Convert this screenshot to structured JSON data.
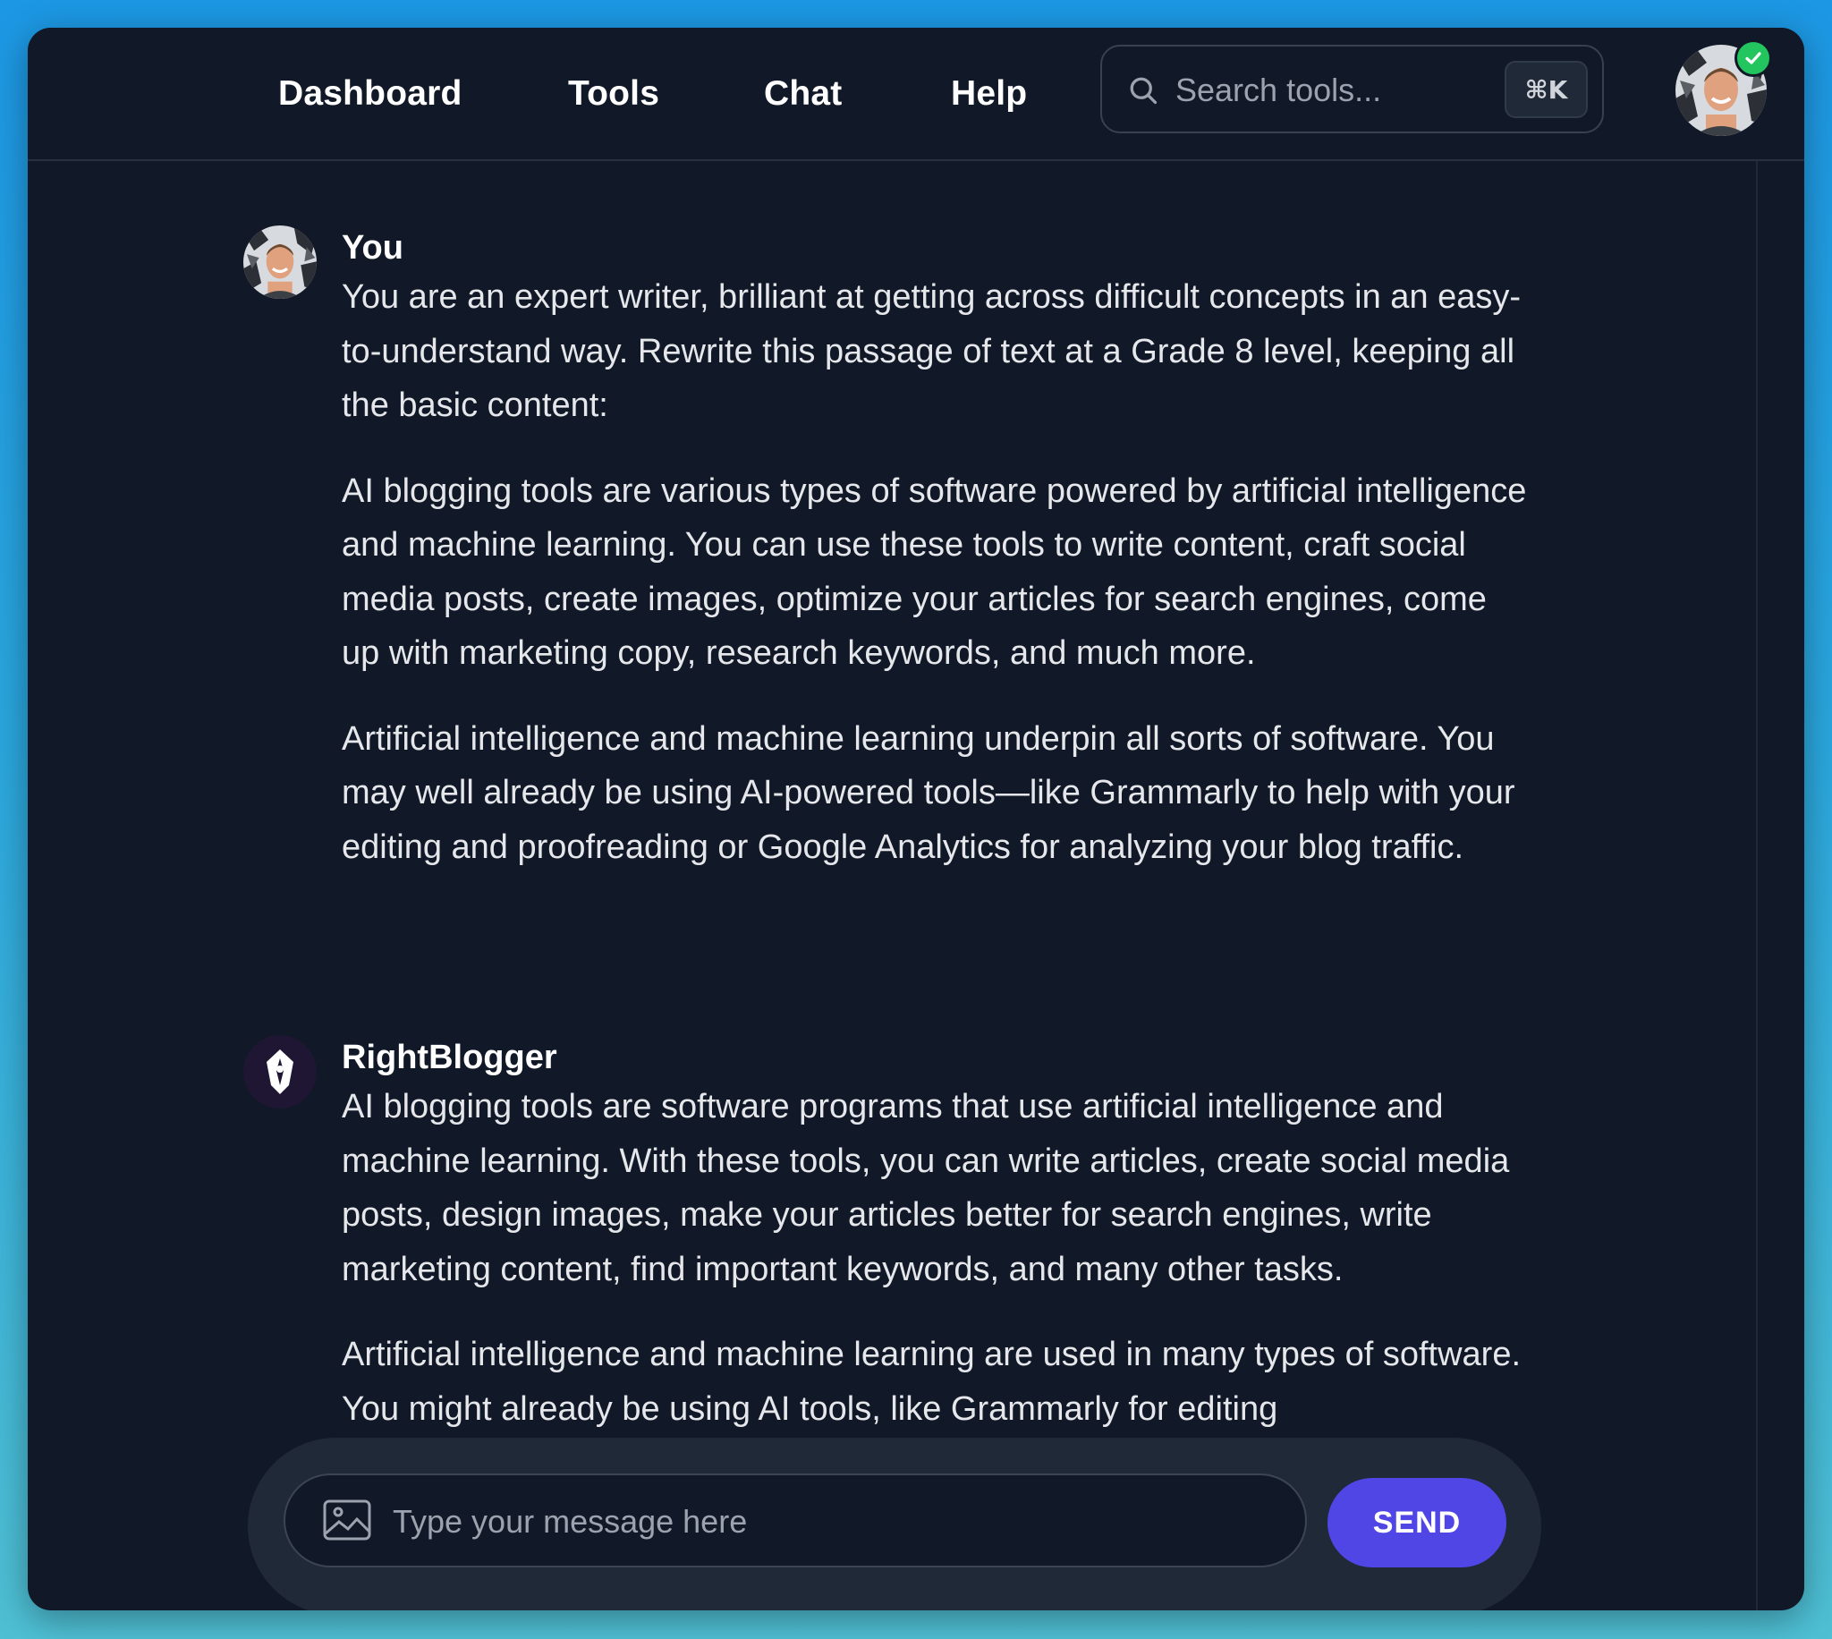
{
  "nav": {
    "items": [
      {
        "label": "Dashboard"
      },
      {
        "label": "Tools"
      },
      {
        "label": "Chat"
      },
      {
        "label": "Help"
      }
    ]
  },
  "search": {
    "placeholder": "Search tools...",
    "shortcut": "⌘K",
    "icon": "search-icon"
  },
  "user_avatar": {
    "status_icon": "check-icon",
    "status_color": "#22c55e"
  },
  "messages": [
    {
      "sender": "You",
      "avatar_icon": "user-avatar",
      "paragraphs": [
        "You are an expert writer, brilliant at getting across difficult concepts in an easy-to-understand way. Rewrite this passage of text at a Grade 8 level, keeping all the basic content:",
        "AI blogging tools are various types of software powered by artificial intelligence and machine learning. You can use these tools to write content, craft social media posts, create images, optimize your articles for search engines, come up with marketing copy, research keywords, and much more.",
        "Artificial intelligence and machine learning underpin all sorts of software. You may well already be using AI-powered tools—like Grammarly to help with your editing and proofreading or Google Analytics for analyzing your blog traffic."
      ]
    },
    {
      "sender": "RightBlogger",
      "avatar_icon": "rightblogger-logo-icon",
      "paragraphs": [
        "AI blogging tools are software programs that use artificial intelligence and machine learning. With these tools, you can write articles, create social media posts, design images, make your articles better for search engines, write marketing content, find important keywords, and many other tasks.",
        "Artificial intelligence and machine learning are used in many types of software. You might already be using AI tools, like Grammarly for editing"
      ]
    }
  ],
  "composer": {
    "placeholder": "Type your message here",
    "send_label": "SEND",
    "attach_icon": "image-icon",
    "accent": "#4f46e5"
  }
}
